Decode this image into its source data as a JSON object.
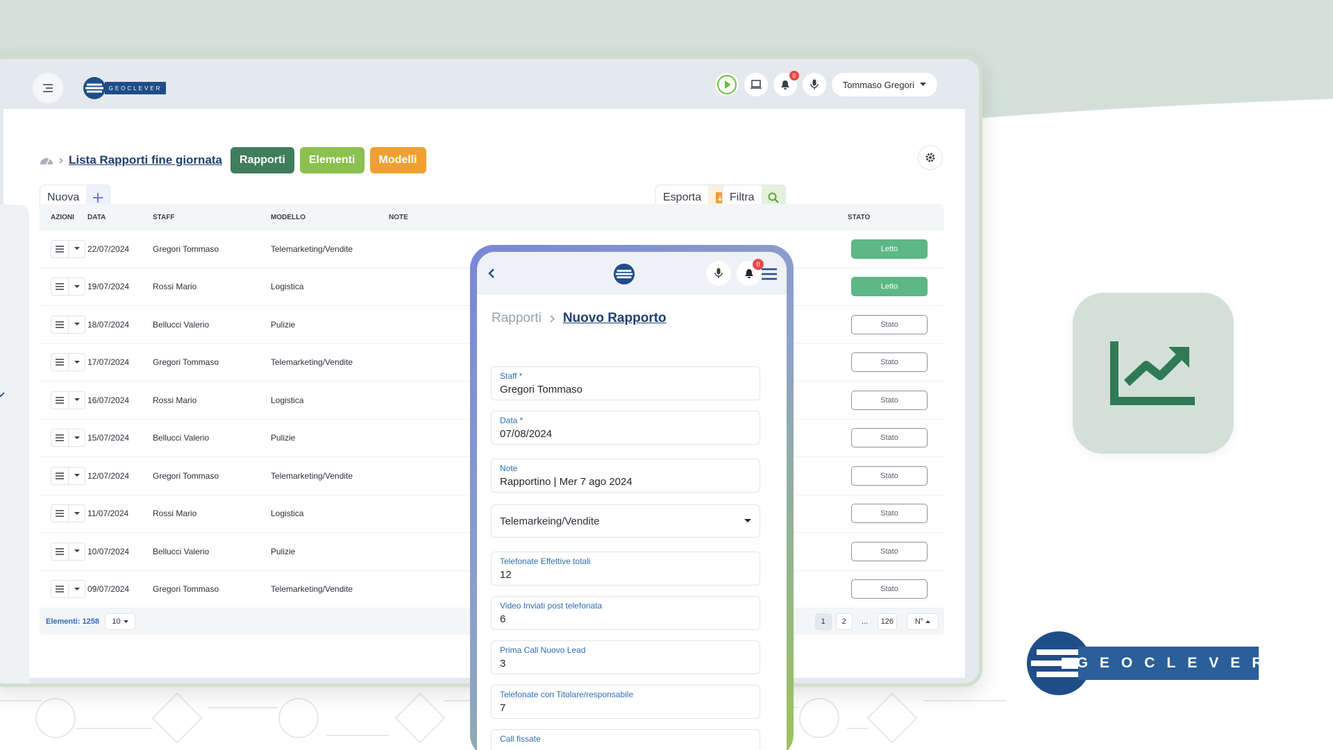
{
  "brand": {
    "name": "GEOCLEVER"
  },
  "topbar": {
    "user": "Tommaso Gregori",
    "bell_badge": "0"
  },
  "header": {
    "title": "Lista Rapporti fine giornata",
    "pills": [
      "Rapporti",
      "Elementi",
      "Modelli"
    ]
  },
  "toolbar": {
    "new_label": "Nuova",
    "export_label": "Esporta",
    "filter_label": "Filtra"
  },
  "table": {
    "headers": {
      "azioni": "AZIONI",
      "data": "DATA",
      "staff": "STAFF",
      "modello": "MODELLO",
      "note": "NOTE",
      "stato": "STATO"
    },
    "rows": [
      {
        "data": "22/07/2024",
        "staff": "Gregori Tommaso",
        "modello": "Telemarketing/Vendite",
        "stato": "Letto"
      },
      {
        "data": "19/07/2024",
        "staff": "Rossi Mario",
        "modello": "Logistica",
        "stato": "Letto"
      },
      {
        "data": "18/07/2024",
        "staff": "Bellucci Valerio",
        "modello": "Pulizie",
        "stato": "Stato"
      },
      {
        "data": "17/07/2024",
        "staff": "Gregori Tommaso",
        "modello": "Telemarketing/Vendite",
        "stato": "Stato"
      },
      {
        "data": "16/07/2024",
        "staff": "Rossi Mario",
        "modello": "Logistica",
        "stato": "Stato"
      },
      {
        "data": "15/07/2024",
        "staff": "Bellucci Valerio",
        "modello": "Pulizie",
        "stato": "Stato"
      },
      {
        "data": "12/07/2024",
        "staff": "Gregori Tommaso",
        "modello": "Telemarketing/Vendite",
        "stato": "Stato"
      },
      {
        "data": "11/07/2024",
        "staff": "Rossi Mario",
        "modello": "Logistica",
        "stato": "Stato"
      },
      {
        "data": "10/07/2024",
        "staff": "Bellucci Valerio",
        "modello": "Pulizie",
        "stato": "Stato"
      },
      {
        "data": "09/07/2024",
        "staff": "Gregori Tommaso",
        "modello": "Telemarketing/Vendite",
        "stato": "Stato"
      }
    ],
    "footer": {
      "count_label": "Elementi: 1258",
      "page_size": "10",
      "pages": [
        "1",
        "2",
        "...",
        "126"
      ],
      "sort_label": "N°"
    }
  },
  "phone": {
    "bell_badge": "0",
    "crumb_parent": "Rapporti",
    "crumb_current": "Nuovo Rapporto",
    "fields": [
      {
        "label": "Staff *",
        "value": "Gregori Tommaso"
      },
      {
        "label": "Data *",
        "value": "07/08/2024"
      },
      {
        "label": "Note",
        "value": "Rapportino | Mer 7 ago 2024"
      },
      {
        "label": "",
        "value": "Telemarkeing/Vendite"
      },
      {
        "label": "Telefonate Effettive totali",
        "value": "12"
      },
      {
        "label": "Video Inviati post telefonata",
        "value": "6"
      },
      {
        "label": "Prima Call Nuovo Lead",
        "value": "3"
      },
      {
        "label": "Telefonate con Titolare/responsabile",
        "value": "7"
      },
      {
        "label": "Call fissate",
        "value": ""
      }
    ]
  },
  "colors": {
    "primary_dark": "#1f4d87",
    "green_pill": "#3f7d5c",
    "lime_pill": "#8cc04f",
    "orange_pill": "#f0a032",
    "letto": "#5db786",
    "mint_bg": "#d3e0da"
  }
}
